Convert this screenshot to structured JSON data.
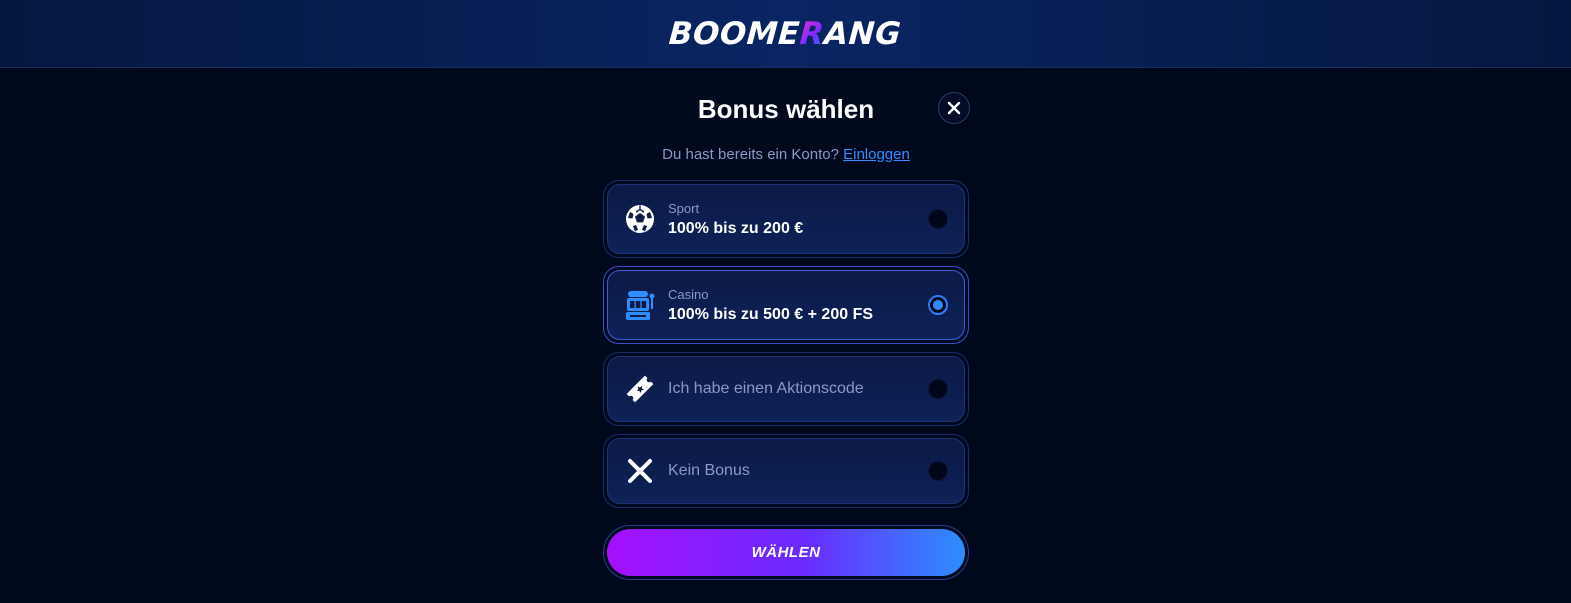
{
  "header": {
    "logo_part1": "BOOME",
    "logo_accent": "R",
    "logo_part2": "ANG"
  },
  "modal": {
    "title": "Bonus wählen",
    "subtitle": "Du hast bereits ein Konto?",
    "login_link": "Einloggen",
    "options": [
      {
        "icon": "soccer-ball-icon",
        "category": "Sport",
        "value": "100% bis zu 200 €",
        "selected": false
      },
      {
        "icon": "slot-machine-icon",
        "category": "Casino",
        "value": "100% bis zu 500 € + 200 FS",
        "selected": true
      },
      {
        "icon": "ticket-icon",
        "label": "Ich habe einen Aktionscode",
        "selected": false
      },
      {
        "icon": "x-icon",
        "label": "Kein Bonus",
        "selected": false
      }
    ],
    "submit_label": "WÄHLEN"
  },
  "colors": {
    "background": "#00081c",
    "accent_blue": "#2f8dff",
    "button_gradient_start": "#a50fff",
    "button_gradient_end": "#2d8dff",
    "muted_text": "#8b98c6"
  }
}
